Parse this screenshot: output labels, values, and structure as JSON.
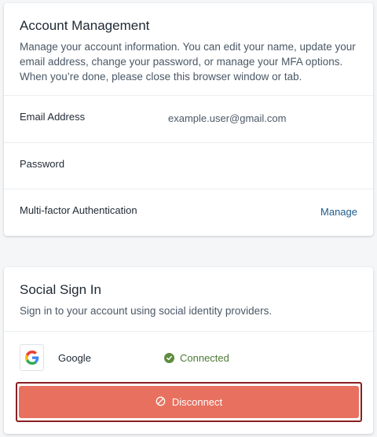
{
  "account": {
    "title": "Account Management",
    "description": "Manage your account information. You can edit your name, update your email address, change your password, or manage your MFA options. When you’re done, please close this browser window or tab.",
    "rows": [
      {
        "label": "Email Address",
        "value": "example.user@gmail.com"
      },
      {
        "label": "Password",
        "value": ""
      },
      {
        "label": "Multi-factor Authentication",
        "action": "Manage"
      }
    ]
  },
  "social": {
    "title": "Social Sign In",
    "description": "Sign in to your account using social identity providers.",
    "provider": {
      "name": "Google",
      "icon": "google-logo-icon",
      "status": "Connected",
      "status_icon": "check-circle-icon"
    },
    "disconnect_label": "Disconnect",
    "disconnect_icon": "ban-icon"
  },
  "colors": {
    "connected": "#5e8c3f",
    "disconnect_button": "#e8705f",
    "focus_outline": "#8a1f22",
    "link": "#1d5a8c"
  }
}
